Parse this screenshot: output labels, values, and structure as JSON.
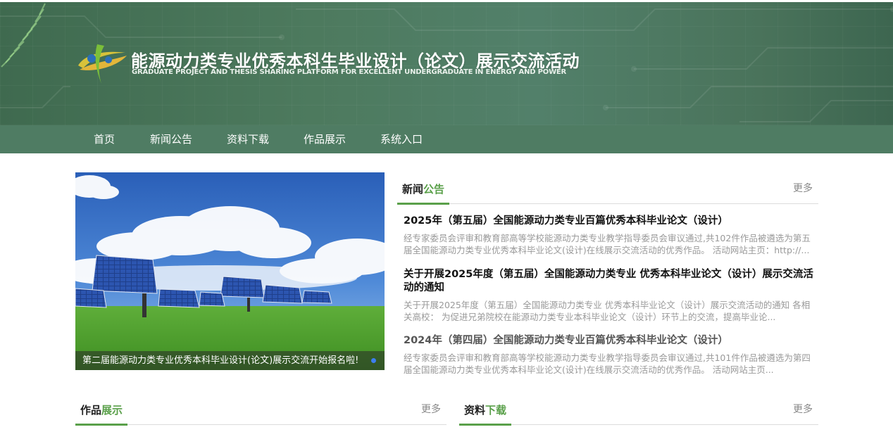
{
  "header": {
    "title": "能源动力类专业优秀本科生毕业设计（论文）展示交流活动",
    "subtitle": "GRADUATE PROJECT AND THESIS SHARING PLATFORM FOR EXCELLENT UNDERGRADUATE IN ENERGY AND POWER",
    "logo_icon": "leaf-swirl-logo-icon",
    "colors": {
      "banner": "#4d7a5e",
      "nav": "#4f7c63",
      "accent": "#5aa04a"
    }
  },
  "nav": {
    "items": [
      {
        "label": "首页"
      },
      {
        "label": "新闻公告"
      },
      {
        "label": "资料下载"
      },
      {
        "label": "作品展示"
      },
      {
        "label": "系统入口"
      }
    ]
  },
  "slider": {
    "caption": "第二届能源动力类专业优秀本科毕业设计(论文)展示交流开始报名啦!",
    "active_dot_color": "#3d7ef0"
  },
  "news_section": {
    "title_a": "新闻",
    "title_b": "公告",
    "more": "更多",
    "items": [
      {
        "title": "2025年（第五届）全国能源动力类专业百篇优秀本科毕业论文（设计）",
        "desc": "经专家委员会评审和教育部高等学校能源动力类专业教学指导委员会审议通过,共102件作品被遴选为第五届全国能源动力类专业优秀本科毕业论文(设计)在线展示交流活动的优秀作品。 活动网站主页：http://..."
      },
      {
        "title": "关于开展2025年度（第五届）全国能源动力类专业 优秀本科毕业论文（设计）展示交流活动的通知",
        "desc": "关于开展2025年度（第五届）全国能源动力类专业 优秀本科毕业论文（设计）展示交流活动的通知 各相关高校： 为促进兄弟院校在能源动力类专业本科毕业论文（设计）环节上的交流，提高毕业论..."
      },
      {
        "title": "2024年（第四届）全国能源动力类专业百篇优秀本科毕业论文（设计）",
        "desc": "经专家委员会评审和教育部高等学校能源动力类专业教学指导委员会审议通过,共101件作品被遴选为第四届全国能源动力类专业优秀本科毕业论文(设计)在线展示交流活动的优秀作品。 活动网站主页..."
      }
    ]
  },
  "works_section": {
    "title_a": "作品",
    "title_b": "展示",
    "more": "更多"
  },
  "downloads_section": {
    "title_a": "资料",
    "title_b": "下载",
    "more": "更多"
  }
}
